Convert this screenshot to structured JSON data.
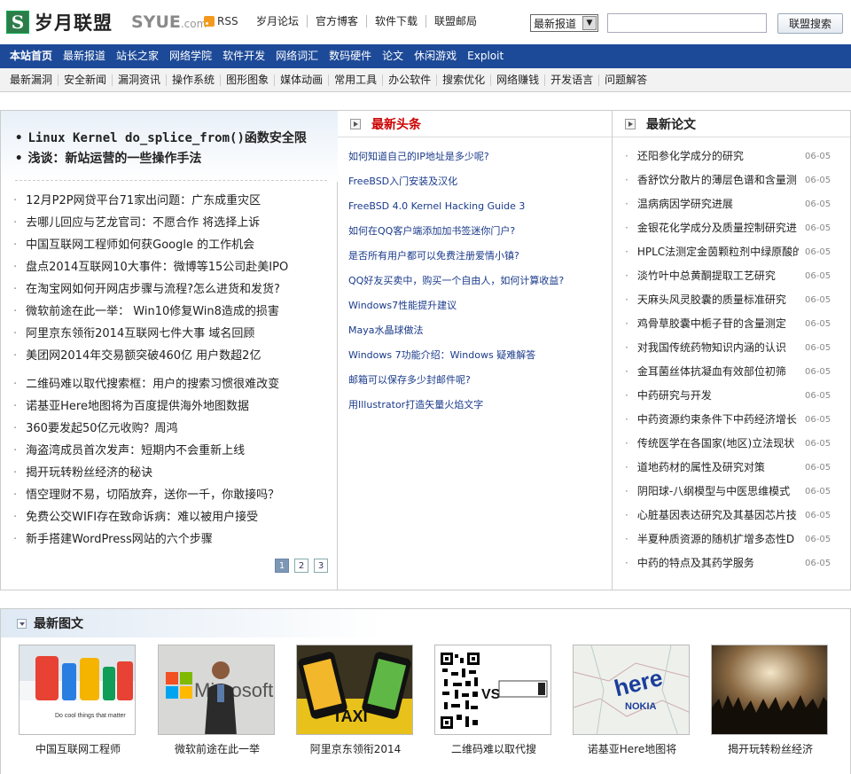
{
  "brand": {
    "logo_letter": "S",
    "name": "岁月联盟",
    "syue": "SYUE",
    "syue_suffix": ".com",
    "rss": "RSS"
  },
  "top_links": [
    "岁月论坛",
    "官方博客",
    "软件下载",
    "联盟邮局"
  ],
  "search": {
    "select_value": "最新报道",
    "button": "联盟搜索"
  },
  "nav_primary": [
    "本站首页",
    "最新报道",
    "站长之家",
    "网络学院",
    "软件开发",
    "网络词汇",
    "数码硬件",
    "论文",
    "休闲游戏",
    "Exploit"
  ],
  "nav_secondary": [
    "最新漏洞",
    "安全新闻",
    "漏洞资讯",
    "操作系统",
    "图形图象",
    "媒体动画",
    "常用工具",
    "办公软件",
    "搜索优化",
    "网络赚钱",
    "开发语言",
    "问题解答"
  ],
  "headlines": [
    "Linux Kernel do_splice_from()函数安全限",
    "浅谈：新站运营的一些操作手法"
  ],
  "news_group1": [
    "12月P2P网贷平台71家出问题：广东成重灾区",
    "去哪儿回应与艺龙官司：不愿合作 将选择上诉",
    "中国互联网工程师如何获Google 的工作机会",
    "盘点2014互联网10大事件：微博等15公司赴美IPO",
    "在淘宝网如何开网店步骤与流程?怎么进货和发货?",
    "微软前途在此一举：  Win10修复Win8造成的损害",
    "阿里京东领衔2014互联网七件大事 域名回顾",
    "美团网2014年交易额突破460亿 用户数超2亿"
  ],
  "news_group2": [
    "二维码难以取代搜索框：用户的搜索习惯很难改变",
    "诺基亚Here地图将为百度提供海外地图数据",
    "360要发起50亿元收购？周鸿",
    "海盗湾成员首次发声：短期内不会重新上线",
    "揭开玩转粉丝经济的秘诀",
    "悟空理财不易，切陌放弃，送你一千，你敢接吗？",
    "免费公交WIFI存在致命诉病：难以被用户接受",
    "新手搭建WordPress网站的六个步骤"
  ],
  "pager": [
    "1",
    "2",
    "3"
  ],
  "latest_heads": {
    "title": "最新头条",
    "title_color": "#cc0000",
    "items": [
      "如何知道自己的IP地址是多少呢?",
      "FreeBSD入门安装及汉化",
      "FreeBSD 4.0 Kernel Hacking Guide 3",
      "如何在QQ客户端添加加书签迷你门户?",
      "是否所有用户都可以免费注册爱情小镇?",
      "QQ好友买卖中，购买一个自由人，如何计算收益?",
      "Windows7性能提升建议",
      "Maya水晶球做法",
      "Windows 7功能介绍：Windows 疑难解答",
      "邮箱可以保存多少封邮件呢?",
      "用Illustrator打造矢量火焰文字"
    ]
  },
  "latest_papers": {
    "title": "最新论文",
    "items": [
      {
        "t": "还阳参化学成分的研究",
        "d": "06-05"
      },
      {
        "t": "香舒饮分散片的薄层色谱和含量测",
        "d": "06-05"
      },
      {
        "t": "温病病因学研究进展",
        "d": "06-05"
      },
      {
        "t": "金银花化学成分及质量控制研究进",
        "d": "06-05"
      },
      {
        "t": "HPLC法测定金茵颗粒剂中绿原酸的",
        "d": "06-05"
      },
      {
        "t": "淡竹叶中总黄酮提取工艺研究",
        "d": "06-05"
      },
      {
        "t": "天麻头风灵胶囊的质量标准研究",
        "d": "06-05"
      },
      {
        "t": "鸡骨草胶囊中栀子苷的含量测定",
        "d": "06-05"
      },
      {
        "t": "对我国传统药物知识内涵的认识",
        "d": "06-05"
      },
      {
        "t": "金耳菌丝体抗凝血有效部位初筛",
        "d": "06-05"
      },
      {
        "t": "中药研究与开发",
        "d": "06-05"
      },
      {
        "t": "中药资源约束条件下中药经济增长",
        "d": "06-05"
      },
      {
        "t": "传统医学在各国家(地区)立法现状",
        "d": "06-05"
      },
      {
        "t": "道地药材的属性及研究对策",
        "d": "06-05"
      },
      {
        "t": "阴阳球-八纲模型与中医思维模式",
        "d": "06-05"
      },
      {
        "t": "心脏基因表达研究及其基因芯片技",
        "d": "06-05"
      },
      {
        "t": "半夏种质资源的随机扩增多态性D",
        "d": "06-05"
      },
      {
        "t": "中药的特点及其药学服务",
        "d": "06-05"
      }
    ]
  },
  "pictures": {
    "title": "最新图文",
    "items": [
      {
        "cap": "中国互联网工程师",
        "img": "google-logo-photo",
        "overlay": "Do cool things that matter"
      },
      {
        "cap": "微软前途在此一举",
        "img": "microsoft-keynote-photo",
        "overlay": "Microsoft"
      },
      {
        "cap": "阿里京东领衔2014",
        "img": "taxi-app-phones-photo",
        "overlay": "TAXI"
      },
      {
        "cap": "二维码难以取代搜",
        "img": "qrcode-vs-searchbox",
        "overlay": "VS"
      },
      {
        "cap": "诺基亚Here地图将",
        "img": "nokia-here-map",
        "overlay": "here",
        "overlay2": "NOKIA"
      },
      {
        "cap": "揭开玩转粉丝经济",
        "img": "concert-crowd-photo"
      }
    ]
  }
}
